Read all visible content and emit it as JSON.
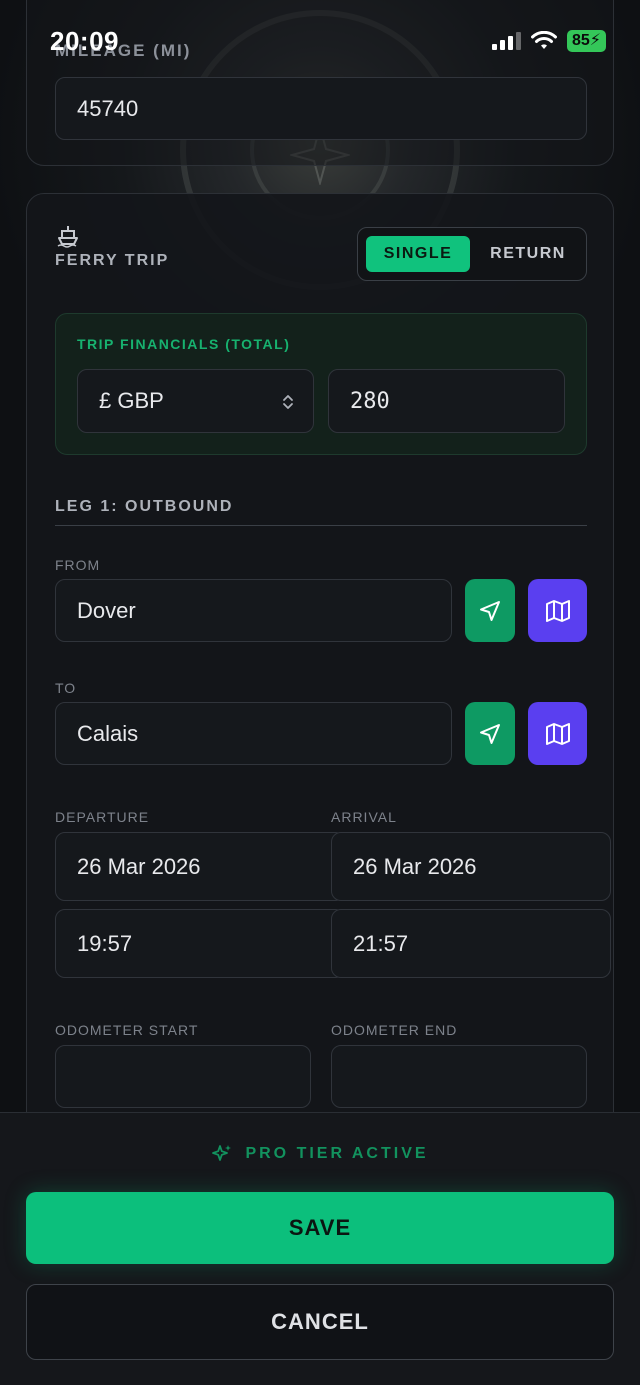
{
  "status_bar": {
    "time": "20:09",
    "battery": "85"
  },
  "mileage": {
    "label": "MILEAGE (MI)",
    "value": "45740"
  },
  "ferry": {
    "title": "FERRY TRIP",
    "toggle": {
      "single": "SINGLE",
      "return": "RETURN",
      "selected": "SINGLE"
    }
  },
  "financials": {
    "title": "TRIP FINANCIALS (TOTAL)",
    "currency": "£ GBP",
    "amount": "280"
  },
  "leg": {
    "title": "LEG 1: OUTBOUND",
    "from_label": "FROM",
    "from_value": "Dover",
    "to_label": "TO",
    "to_value": "Calais",
    "departure_label": "DEPARTURE",
    "departure_date": "26 Mar 2026",
    "departure_time": "19:57",
    "arrival_label": "ARRIVAL",
    "arrival_date": "26 Mar 2026",
    "arrival_time": "21:57",
    "odometer_start_label": "ODOMETER START",
    "odometer_start_value": "",
    "odometer_end_label": "ODOMETER END",
    "odometer_end_value": ""
  },
  "footer": {
    "pro_text": "PRO TIER ACTIVE",
    "save": "SAVE",
    "cancel": "CANCEL"
  },
  "colors": {
    "accent_green": "#10c27d",
    "accent_purple": "#5a3ff0",
    "background": "#0e1013"
  },
  "icons": {
    "ferry": "ship-icon",
    "locate": "navigation-arrow-icon",
    "map": "map-icon",
    "pro": "sparkle-icon"
  }
}
